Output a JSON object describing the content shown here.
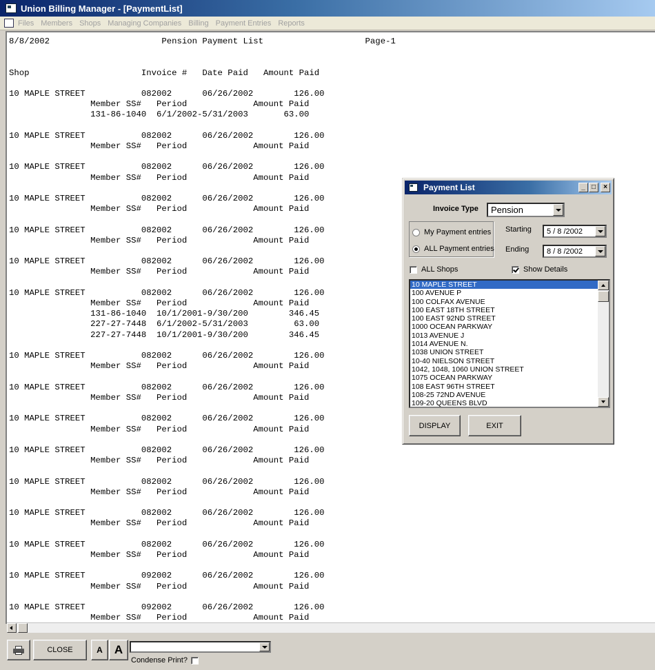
{
  "app": {
    "title": "Union Billing Manager - [PaymentList]",
    "menu": [
      "Files",
      "Members",
      "Shops",
      "Managing Companies",
      "Billing",
      "Payment Entries",
      "Reports"
    ]
  },
  "report": {
    "text": "8/8/2002                      Pension Payment List                    Page-1\n\n\nShop                      Invoice #   Date Paid   Amount Paid\n\n10 MAPLE STREET           082002      06/26/2002        126.00\n                Member SS#   Period             Amount Paid\n                131-86-1040  6/1/2002-5/31/2003       63.00\n\n10 MAPLE STREET           082002      06/26/2002        126.00\n                Member SS#   Period             Amount Paid\n\n10 MAPLE STREET           082002      06/26/2002        126.00\n                Member SS#   Period             Amount Paid\n\n10 MAPLE STREET           082002      06/26/2002        126.00\n                Member SS#   Period             Amount Paid\n\n10 MAPLE STREET           082002      06/26/2002        126.00\n                Member SS#   Period             Amount Paid\n\n10 MAPLE STREET           082002      06/26/2002        126.00\n                Member SS#   Period             Amount Paid\n\n10 MAPLE STREET           082002      06/26/2002        126.00\n                Member SS#   Period             Amount Paid\n                131-86-1040  10/1/2001-9/30/200        346.45\n                227-27-7448  6/1/2002-5/31/2003         63.00\n                227-27-7448  10/1/2001-9/30/200        346.45\n\n10 MAPLE STREET           082002      06/26/2002        126.00\n                Member SS#   Period             Amount Paid\n\n10 MAPLE STREET           082002      06/26/2002        126.00\n                Member SS#   Period             Amount Paid\n\n10 MAPLE STREET           082002      06/26/2002        126.00\n                Member SS#   Period             Amount Paid\n\n10 MAPLE STREET           082002      06/26/2002        126.00\n                Member SS#   Period             Amount Paid\n\n10 MAPLE STREET           082002      06/26/2002        126.00\n                Member SS#   Period             Amount Paid\n\n10 MAPLE STREET           082002      06/26/2002        126.00\n                Member SS#   Period             Amount Paid\n\n10 MAPLE STREET           082002      06/26/2002        126.00\n                Member SS#   Period             Amount Paid\n\n10 MAPLE STREET           092002      06/26/2002        126.00\n                Member SS#   Period             Amount Paid\n\n10 MAPLE STREET           092002      06/26/2002        126.00\n                Member SS#   Period             Amount Paid"
  },
  "toolbar": {
    "close_label": "CLOSE",
    "font_small_label": "A",
    "font_large_label": "A",
    "font_combo_value": "",
    "condense_label": "Condense Print?",
    "condense_checked": false
  },
  "dialog": {
    "title": "Payment List",
    "min_label": "_",
    "max_label": "□",
    "close_label": "×",
    "invoice_type_label": "Invoice Type",
    "invoice_type_value": "Pension",
    "my_entries_label": "My Payment entries",
    "all_entries_label": "ALL Payment entries",
    "selected_entries": "all",
    "starting_label": "Starting",
    "starting_value": "5 / 8 /2002",
    "ending_label": "Ending",
    "ending_value": "8 / 8 /2002",
    "all_shops_label": "ALL Shops",
    "all_shops_checked": false,
    "show_details_label": "Show Details",
    "show_details_checked": true,
    "shops": [
      "10 MAPLE STREET",
      "100 AVENUE P",
      "100 COLFAX AVENUE",
      "100 EAST 18TH STREET",
      "100 EAST 92ND STREET",
      "1000 OCEAN PARKWAY",
      "1013 AVENUE J",
      "1014 AVENUE N.",
      "1038 UNION STREET",
      "10-40 NIELSON STREET",
      "1042, 1048, 1060 UNION STREET",
      "1075 OCEAN PARKWAY",
      "108 EAST 96TH STREET",
      "108-25 72ND AVENUE",
      "109-20 QUEENS BLVD"
    ],
    "display_label": "DISPLAY",
    "exit_label": "EXIT"
  }
}
